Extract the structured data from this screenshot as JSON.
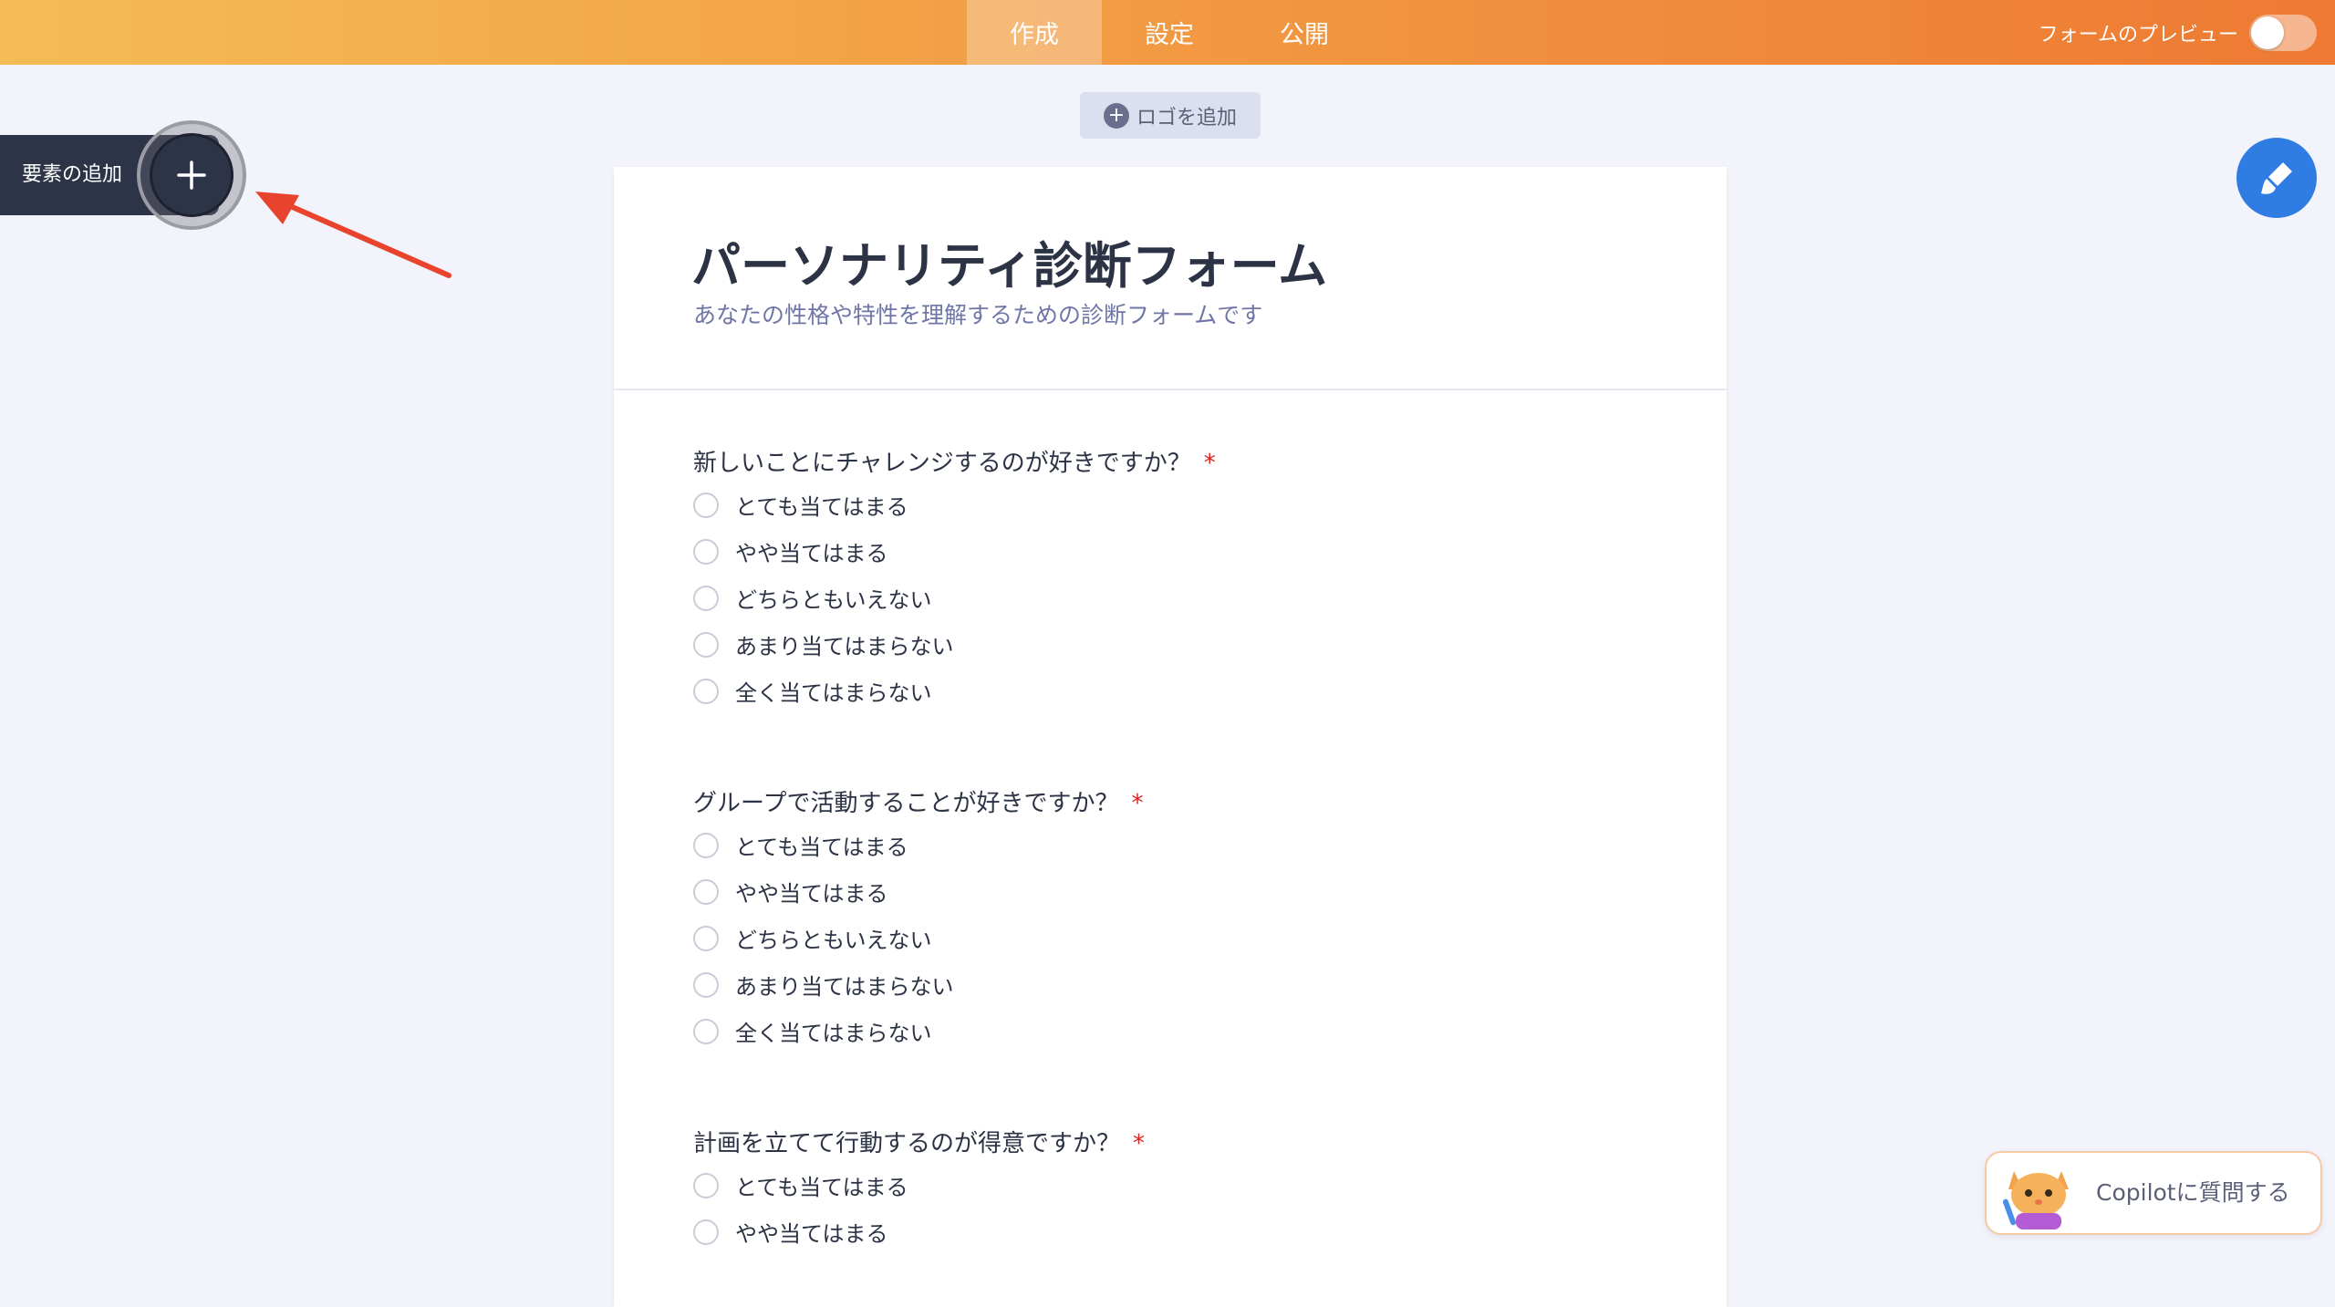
{
  "topbar": {
    "tabs": [
      {
        "label": "作成",
        "active": true
      },
      {
        "label": "設定",
        "active": false
      },
      {
        "label": "公開",
        "active": false
      }
    ],
    "preview_label": "フォームのプレビュー",
    "preview_on": false
  },
  "sidebar": {
    "add_element_label": "要素の追加"
  },
  "logo_button": {
    "label": "ロゴを追加"
  },
  "form": {
    "title": "パーソナリティ診断フォーム",
    "subtitle": "あなたの性格や特性を理解するための診断フォームです",
    "questions": [
      {
        "label": "新しいことにチャレンジするのが好きですか？",
        "required_mark": "*",
        "options": [
          "とても当てはまる",
          "やや当てはまる",
          "どちらともいえない",
          "あまり当てはまらない",
          "全く当てはまらない"
        ]
      },
      {
        "label": "グループで活動することが好きですか？",
        "required_mark": "*",
        "options": [
          "とても当てはまる",
          "やや当てはまる",
          "どちらともいえない",
          "あまり当てはまらない",
          "全く当てはまらない"
        ]
      },
      {
        "label": "計画を立てて行動するのが得意ですか？",
        "required_mark": "*",
        "options": [
          "とても当てはまる",
          "やや当てはまる"
        ]
      }
    ]
  },
  "copilot": {
    "label": "Copilotに質問する"
  },
  "colors": {
    "accent_orange": "#ee7a33",
    "designer_blue": "#2f7ce3",
    "required_red": "#e02020",
    "dark_panel": "#2e3447"
  },
  "icons": [
    "plus-icon",
    "paint-brush-icon",
    "cat-avatar-icon",
    "arrow-annotation"
  ]
}
